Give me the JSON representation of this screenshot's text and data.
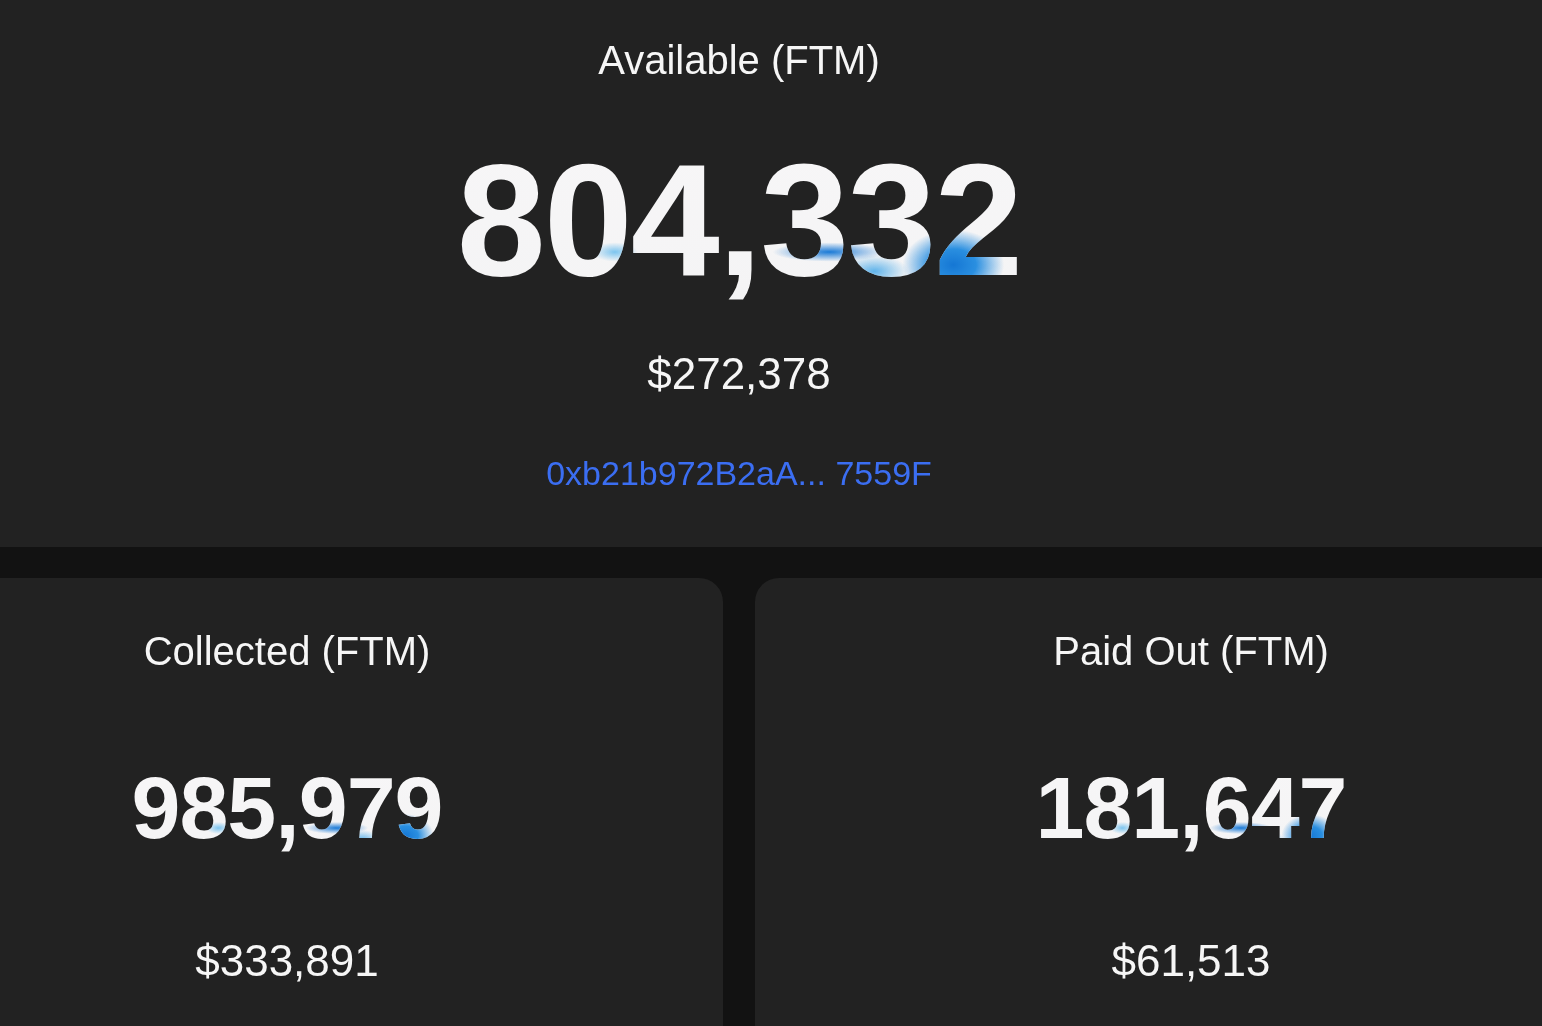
{
  "summary": {
    "title": "Available (FTM)",
    "amount": "804,332",
    "value": "$272,378",
    "address": "0xb21b972B2aA... 7559F"
  },
  "cards": [
    {
      "title": "Collected (FTM)",
      "amount": "985,979",
      "value": "$333,891"
    },
    {
      "title": "Paid Out (FTM)",
      "amount": "181,647",
      "value": "$61,513"
    }
  ]
}
